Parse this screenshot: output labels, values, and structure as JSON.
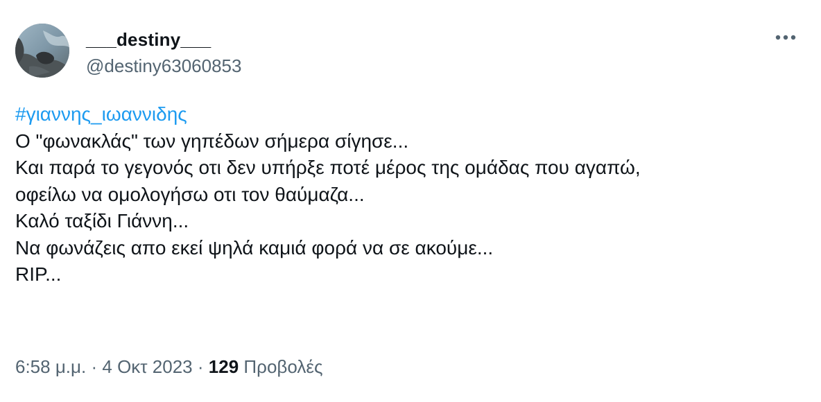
{
  "user": {
    "display_name": "___destiny___",
    "handle": "@destiny63060853"
  },
  "more_icon": "more-horizontal-icon",
  "tweet": {
    "hashtag": "#γιαννης_ιωαννιδης",
    "lines": [
      "Ο \"φωνακλάς\" των γηπέδων σήμερα σίγησε...",
      "Και παρά το γεγονός οτι δεν υπήρξε ποτέ μέρος της ομάδας που αγαπώ,",
      "οφείλω να ομολογήσω οτι τον θαύμαζα...",
      "Καλό ταξίδι Γιάννη...",
      "Να φωνάζεις απο εκεί ψηλά καμιά φορά να σε ακούμε...",
      "RIP..."
    ]
  },
  "meta": {
    "time": "6:58 μ.μ.",
    "separator": "·",
    "date": "4 Οκτ 2023",
    "views_count": "129",
    "views_label": "Προβολές"
  },
  "colors": {
    "hashtag": "#1d9bf0",
    "secondary_text": "#536471",
    "primary_text": "#0f1419"
  }
}
